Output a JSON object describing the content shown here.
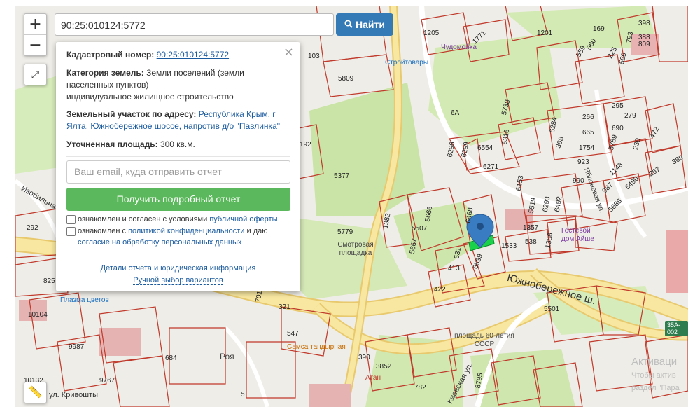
{
  "search": {
    "value": "90:25:010124:5772",
    "button_label": "Найти"
  },
  "controls": {
    "zoom_in": "+",
    "zoom_out": "−"
  },
  "popup": {
    "close": "×",
    "cadastral_label": "Кадастровый номер:",
    "cadastral_value": "90:25:010124:5772",
    "category_label": "Категория земель:",
    "category_value": "Земли поселений (земли населенных пунктов)",
    "category_use": "индивидуальное жилищное строительство",
    "address_label": "Земельный участок по адресу:",
    "address_value": "Республика Крым, г Ялта, Южнобережное шоссе, напротив д/о \"Павлинка\"",
    "area_label": "Уточненная площадь:",
    "area_value": "300 кв.м.",
    "email_placeholder": "Ваш email, куда отправить отчет",
    "get_report": "Получить подробный отчет",
    "check1_text": "ознакомлен и согласен с условиями ",
    "check1_link": "публичной оферты",
    "check2_text": "ознакомлен с ",
    "check2_link": "политикой конфиденциальности",
    "check2_mid": " и даю ",
    "check2_link2": "согласие на обработку персональных данных",
    "details_link": "Детали отчета и юридическая информация",
    "manual_link": "Ручной выбор вариантов"
  },
  "map": {
    "streets": [
      "Южнобережное ш.",
      "Киевская ул.",
      "Изобильная",
      "ул. Кривошты",
      "Яблоневая ул."
    ],
    "pois": [
      "Стройтовары",
      "Чудомойка",
      "Гостевой дом Айше",
      "Смотровая площадка",
      "Самса тандырная",
      "Плазма цветов",
      "Атан",
      "площадь 60-летия СССР",
      "Роя"
    ],
    "road_shields": [
      "35A-002"
    ],
    "watermark": [
      "Активаци",
      "Чтобы актив",
      "раздел \"Пара"
    ],
    "plot_numbers": [
      "1205",
      "1201",
      "1771",
      "103",
      "5809",
      "5738",
      "6A",
      "6296",
      "6299",
      "6554",
      "6316",
      "6271",
      "266",
      "295",
      "279",
      "6284",
      "665",
      "690",
      "368",
      "1754",
      "5789",
      "239",
      "472",
      "923",
      "1148",
      "6490",
      "267",
      "990",
      "987",
      "5688",
      "5377",
      "192",
      "6153",
      "5519",
      "6293",
      "6492",
      "5666",
      "1382",
      "5507",
      "5779",
      "5667",
      "6468",
      "531",
      "6539",
      "413",
      "422",
      "1357",
      "538",
      "1533",
      "1356",
      "5501",
      "547",
      "684",
      "5",
      "782",
      "390",
      "3852",
      "8795",
      "10104",
      "9987",
      "10132",
      "9767",
      "292",
      "825",
      "321",
      "560",
      "569",
      "225",
      "793",
      "398",
      "388",
      "809",
      "169",
      "559",
      "369",
      "701"
    ]
  },
  "colors": {
    "plot_line": "#c0392b",
    "highlight_plot": "#19d24a",
    "marker": "#3a7cc2",
    "search_button": "#337ab7",
    "report_button": "#5cb85c",
    "road_yellow": "#f6e48a",
    "park_green": "#c8e6a8"
  }
}
